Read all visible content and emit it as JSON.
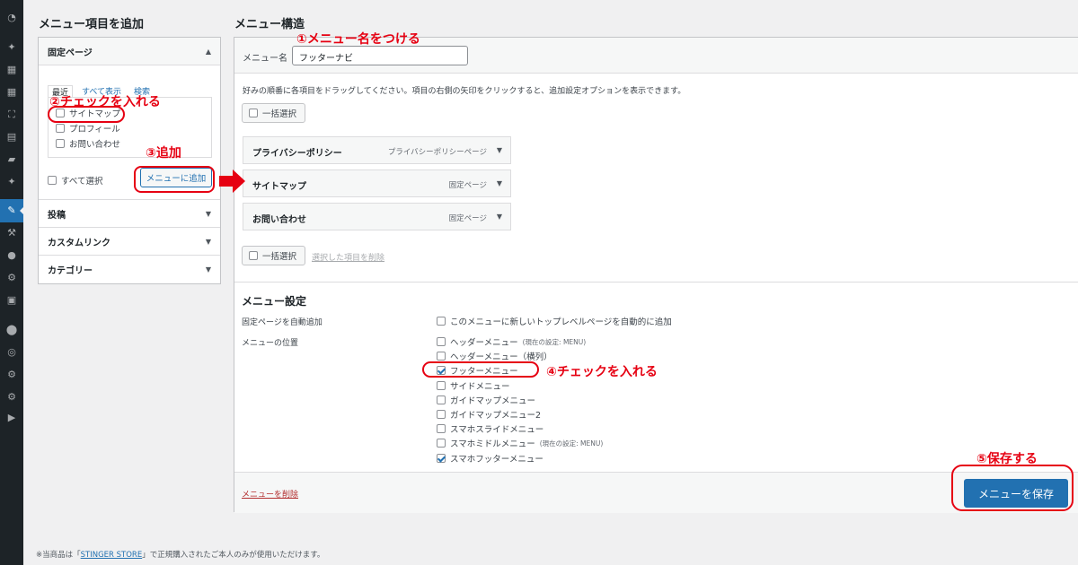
{
  "colors": {
    "accent": "#2271b1",
    "annotation": "#e60012",
    "sidebar": "#1d2327",
    "delete": "#b32d2e"
  },
  "sidebar_icons": [
    "dashboard-icon",
    "pin-icon",
    "blocks-icon",
    "grid-icon",
    "media-icon",
    "pages-icon",
    "comments-icon",
    "pin2-icon",
    "appearance-icon",
    "plugins-icon",
    "users-icon",
    "tools-icon",
    "settings-block-icon",
    "circle-icon",
    "wp-icon",
    "gear-icon",
    "gear2-icon",
    "play-icon"
  ],
  "left": {
    "title": "メニュー項目を追加",
    "pages": {
      "header": "固定ページ",
      "tabs": [
        "最近",
        "すべて表示",
        "検索"
      ],
      "items": [
        "サイトマップ",
        "プロフィール",
        "お問い合わせ"
      ],
      "select_all": "すべて選択",
      "add_button": "メニューに追加"
    },
    "sections": [
      "投稿",
      "カスタムリンク",
      "カテゴリー"
    ]
  },
  "right": {
    "title": "メニュー構造",
    "name_label": "メニュー名",
    "name_value": "フッターナビ",
    "instructions": "好みの順番に各項目をドラッグしてください。項目の右側の矢印をクリックすると、追加設定オプションを表示できます。",
    "bulk_select": "一括選択",
    "remove_selected": "選択した項目を削除",
    "items": [
      {
        "title": "プライバシーポリシー",
        "type": "プライバシーポリシーページ"
      },
      {
        "title": "サイトマップ",
        "type": "固定ページ"
      },
      {
        "title": "お問い合わせ",
        "type": "固定ページ"
      }
    ],
    "settings": {
      "title": "メニュー設定",
      "auto_add_label": "固定ページを自動追加",
      "auto_add_option": "このメニューに新しいトップレベルページを自動的に追加",
      "location_label": "メニューの位置",
      "locations": [
        {
          "name": "ヘッダーメニュー",
          "note": "(現在の設定: MENU)",
          "checked": false
        },
        {
          "name": "ヘッダーメニュー（横列）",
          "note": "",
          "checked": false
        },
        {
          "name": "フッターメニュー",
          "note": "",
          "checked": true
        },
        {
          "name": "サイドメニュー",
          "note": "",
          "checked": false
        },
        {
          "name": "ガイドマップメニュー",
          "note": "",
          "checked": false
        },
        {
          "name": "ガイドマップメニュー2",
          "note": "",
          "checked": false
        },
        {
          "name": "スマホスライドメニュー",
          "note": "",
          "checked": false
        },
        {
          "name": "スマホミドルメニュー",
          "note": "(現在の設定: MENU)",
          "checked": false
        },
        {
          "name": "スマホフッターメニュー",
          "note": "",
          "checked": true
        }
      ]
    },
    "delete_link": "メニューを削除",
    "save_button": "メニューを保存"
  },
  "annotations": {
    "a1": "①メニュー名をつける",
    "a2": "②チェックを入れる",
    "a3": "③追加",
    "a4": "④チェックを入れる",
    "a5": "⑤保存する"
  },
  "footer": {
    "pre": "※当商品は「",
    "store": "STINGER STORE",
    "post": "」で正規購入されたご本人のみが使用いただけます。"
  }
}
